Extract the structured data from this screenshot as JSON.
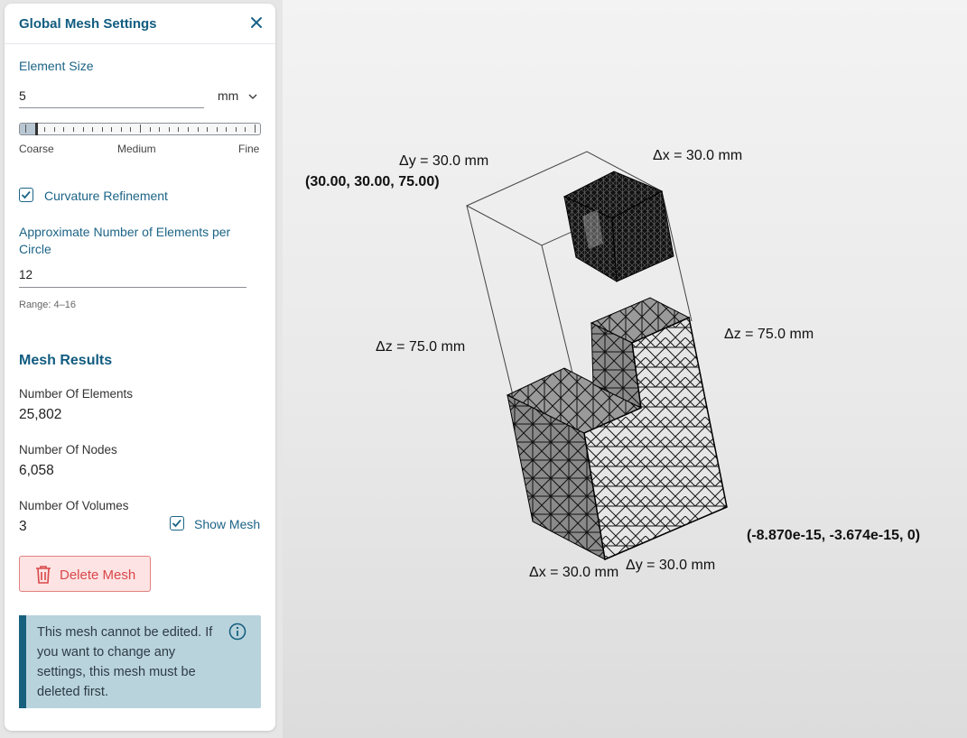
{
  "panel": {
    "title": "Global Mesh Settings",
    "element_size": {
      "label": "Element Size",
      "value": "5",
      "unit": "mm",
      "slider_level": 0.05,
      "slider_labels": [
        "Coarse",
        "Medium",
        "Fine"
      ]
    },
    "curvature_refinement": {
      "label": "Curvature Refinement",
      "checked": true
    },
    "elements_per_circle": {
      "label_line1": "Approximate Number of Elements per",
      "label_line2": "Circle",
      "value": "12",
      "range_hint": "Range: 4–16"
    },
    "results": {
      "title": "Mesh Results",
      "elements_label": "Number Of Elements",
      "elements_value": "25,802",
      "nodes_label": "Number Of Nodes",
      "nodes_value": "6,058",
      "volumes_label": "Number Of Volumes",
      "volumes_value": "3",
      "show_mesh_label": "Show Mesh",
      "show_mesh_checked": true
    },
    "delete_button": "Delete Mesh",
    "info_message": "This mesh cannot be edited. If you want to change any settings, this mesh must be deleted first."
  },
  "viewport": {
    "dimensions": {
      "dy_top": "Δy = 30.0 mm",
      "dx_top": "Δx = 30.0 mm",
      "dz_left": "Δz = 75.0 mm",
      "dz_right": "Δz = 75.0 mm",
      "dx_bottom": "Δx = 30.0 mm",
      "dy_bottom": "Δy = 30.0 mm"
    },
    "coord_max": "(30.00, 30.00, 75.00)",
    "coord_min": "(-8.870e-15, -3.674e-15, 0)"
  },
  "colors": {
    "accent": "#125c80",
    "danger": "#d9474a",
    "info_bg": "#b9d3dd",
    "info_bar": "#17607e"
  }
}
